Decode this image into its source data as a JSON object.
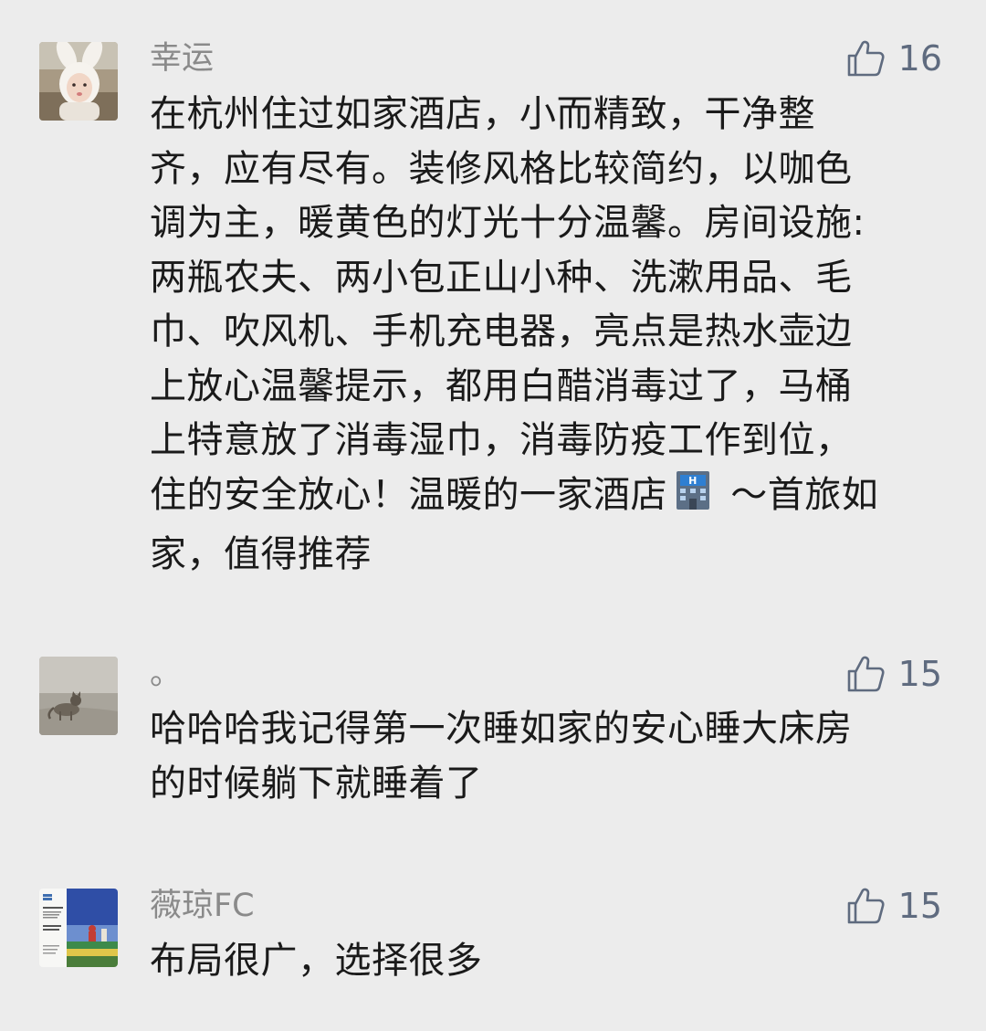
{
  "comments": [
    {
      "username": "幸运",
      "likes": "16",
      "content_before_emoji": "在杭州住过如家酒店，小而精致，干净整\n齐，应有尽有。装修风格比较简约，以咖色\n调为主，暖黄色的灯光十分温馨。房间设施:\n两瓶农夫、两小包正山小种、洗漱用品、毛\n巾、吹风机、手机充电器，亮点是热水壶边\n上放心温馨提示，都用白醋消毒过了，马桶\n上特意放了消毒湿巾，消毒防疫工作到位，\n住的安全放心！温暖的一家酒店",
      "emoji": "hotel-emoji",
      "content_after_emoji": " ～首旅如\n家，值得推荐"
    },
    {
      "username": "。",
      "likes": "15",
      "content": "哈哈哈我记得第一次睡如家的安心睡大床房\n的时候躺下就睡着了"
    },
    {
      "username": "薇琼FC",
      "likes": "15",
      "content": "布局很广，选择很多"
    }
  ],
  "icons": {
    "like": "thumbs-up-icon"
  },
  "colors": {
    "background": "#ececec",
    "username": "#8a8a8a",
    "text": "#1a1a1a",
    "like": "#5f6b7f"
  }
}
